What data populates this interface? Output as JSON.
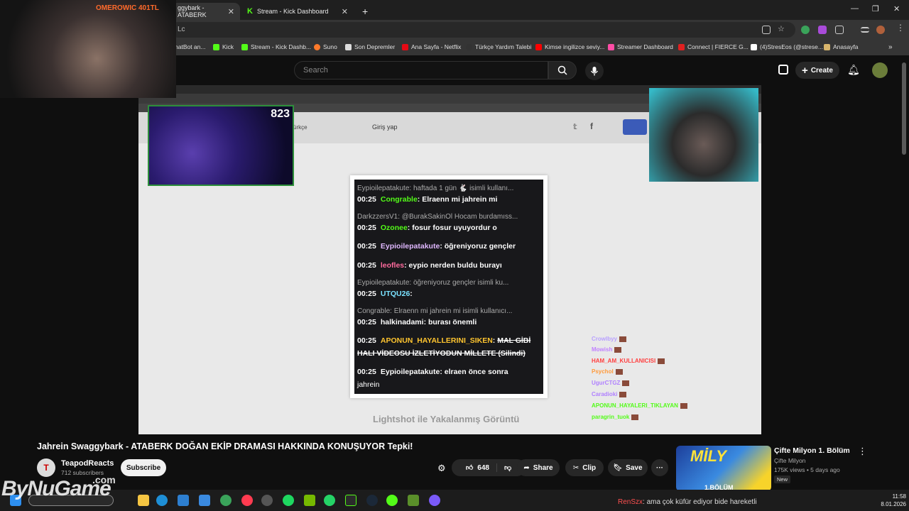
{
  "browser": {
    "tabs": [
      {
        "label": "ggybark - ATABERK"
      },
      {
        "label": "Stream - Kick Dashboard"
      }
    ],
    "new_tab": "+",
    "address": "Lc",
    "bookmarks": [
      {
        "label": "hatBot an...",
        "color": "#888"
      },
      {
        "label": "Kick",
        "color": "#53fc18"
      },
      {
        "label": "Stream - Kick Dashb...",
        "color": "#53fc18"
      },
      {
        "label": "Suno",
        "color": "#ff7a2b"
      },
      {
        "label": "Son Depremler",
        "color": "#ddd"
      },
      {
        "label": "Ana Sayfa - Netflix",
        "color": "#e50914"
      },
      {
        "label": "Türkçe Yardım Talebi",
        "color": "#333"
      },
      {
        "label": "Kimse ingilizce seviy...",
        "color": "#ff0000"
      },
      {
        "label": "Streamer Dashboard",
        "color": "#ff4da6"
      },
      {
        "label": "Connect | FIERCE G...",
        "color": "#e02020"
      },
      {
        "label": "(4)StresEos (@strese...",
        "color": "#fff"
      },
      {
        "label": "Anasayfa",
        "color": "#d8b56c"
      }
    ]
  },
  "youtube": {
    "search_placeholder": "Search",
    "create_label": "Create"
  },
  "video": {
    "inner_login": "Giriş yap",
    "inner_lang": "ürkçe",
    "caption": "Lightshot ile Yakalanmış Görüntü",
    "cam1_label": "OMEROWIC 401TL",
    "cam2_count": "823",
    "chat": [
      {
        "reply": "Eypioilepatakute: haftada 1 gün 🐇 isimli kullanı..."
      },
      {
        "time": "00:25",
        "user": "Congrable",
        "msg": "Elraenn mi jahrein mi",
        "ucls": "u-green"
      },
      {
        "reply": "DarkzzersV1: @BurakSakinOl Hocam burdamıss..."
      },
      {
        "time": "00:25",
        "user": "Ozonee",
        "msg": "fosur fosur uyuyordur o",
        "ucls": "u-green"
      },
      {
        "time": "00:25",
        "user": "Eypioilepatakute",
        "msg": "öğreniyoruz gençler",
        "ucls": "u-purple"
      },
      {
        "time": "00:25",
        "user": "leofles",
        "msg": "eypio nerden buldu burayı",
        "ucls": "u-pink"
      },
      {
        "reply": "Eypioilepatakute: öğreniyoruz gençler isimli ku..."
      },
      {
        "time": "00:25",
        "user": "UTQU26",
        "msg": "",
        "ucls": "u-cyan"
      },
      {
        "reply": "Congrable: Elraenn mi jahrein mi isimli kullanıcı..."
      },
      {
        "time": "00:25",
        "user": "halkinadami",
        "msg": "burası önemli",
        "ucls": "u-white"
      },
      {
        "time": "00:25",
        "user": "APONUN_HAYALLERINI_SIKEN",
        "msg": "MAL GİBİ",
        "ucls": "u-gold",
        "strike": true
      },
      {
        "cont": "HALI VİDEOSU İZLETİYODUN MİLLETE (Silindi)",
        "strike": true
      },
      {
        "time": "00:25",
        "user": "Eypioilepatakute",
        "msg": "elraen önce sonra",
        "ucls": "u-white"
      },
      {
        "cont": "jahrein"
      }
    ],
    "overlay_chat": [
      {
        "user": "Crowlbyy",
        "color": "#b8a0ff"
      },
      {
        "user": "Mowish",
        "color": "#c080ff"
      },
      {
        "user": "HAM_AM_KULLANICISI",
        "color": "#ff4040"
      },
      {
        "user": "Psychol",
        "color": "#ff9a3a"
      },
      {
        "user": "UgurCTGZ",
        "color": "#b080ff"
      },
      {
        "user": "Caradioki",
        "color": "#b080ff"
      },
      {
        "user": "APONUN_HAYALERI_TIKLAYAN",
        "color": "#53fc18"
      },
      {
        "user": "paragrin_tuok",
        "color": "#53fc18"
      }
    ]
  },
  "meta": {
    "title": "Jahrein Swaggybark - ATABERK DOĞAN EKİP DRAMASI HAKKINDA KONUŞUYOR Tepki!",
    "channel": "TeapodReacts",
    "subs": "712 subscribers",
    "subscribe": "Subscribe",
    "likes": "648",
    "share": "Share",
    "clip": "Clip",
    "save": "Save",
    "more": "···"
  },
  "recommendation": {
    "thumb_logo": "MİLY",
    "thumb_episode": "1.BÖLÜM",
    "title": "Çifte Milyon 1. Bölüm",
    "channel": "Çifte Milyon",
    "meta": "175K views • 5 days ago",
    "badge": "New"
  },
  "taskbar": {
    "time": "11:58",
    "date": "8.01.2026",
    "ticker_user": "RenSzx",
    "ticker_msg": ": ama çok küfür ediyor bide hareketli",
    "watermark": "ByNuGame",
    "watermark_com": ".com"
  }
}
